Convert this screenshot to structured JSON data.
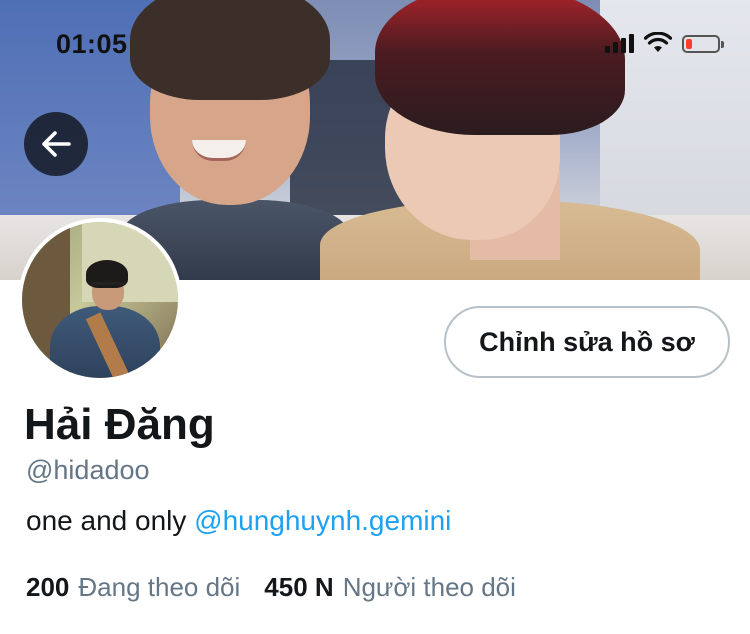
{
  "status_bar": {
    "time": "01:05",
    "icons": [
      "cellular-signal-icon",
      "wifi-icon",
      "battery-low-icon"
    ],
    "battery_color": "#ff3b30"
  },
  "header": {
    "back_icon": "arrow-left-icon"
  },
  "profile": {
    "edit_button_label": "Chỉnh sửa hồ sơ",
    "display_name": "Hải Đăng",
    "username": "@hidadoo",
    "bio_text": "one and only ",
    "bio_mention": "@hunghuynh.gemini",
    "following_count": "200",
    "following_label": "Đang theo dõi",
    "followers_count": "450 N",
    "followers_label": "Người theo dõi"
  },
  "colors": {
    "accent": "#1da1f2",
    "text_primary": "#14171a",
    "text_secondary": "#657786",
    "button_border": "#b8c0c8"
  }
}
